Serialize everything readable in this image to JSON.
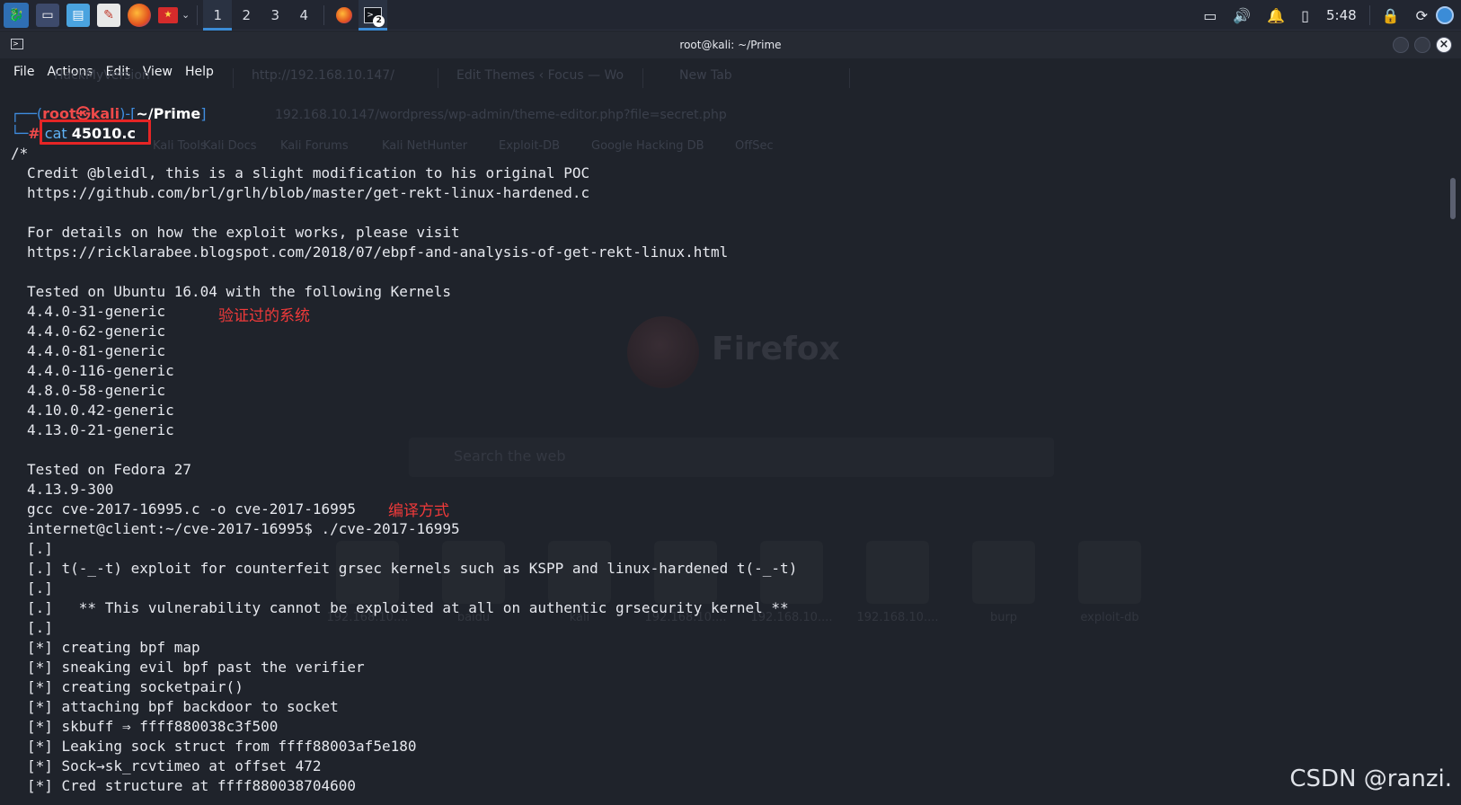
{
  "taskbar": {
    "workspaces": [
      "1",
      "2",
      "3",
      "4"
    ],
    "active_workspace": "1",
    "terminal_badge": "2",
    "clock": "5:48",
    "icons": [
      "kali-menu-icon",
      "terminal-icon",
      "file-manager-icon",
      "text-editor-icon",
      "firefox-icon",
      "flag-icon"
    ]
  },
  "window": {
    "title": "root@kali: ~/Prime"
  },
  "menu": [
    "File",
    "Actions",
    "Edit",
    "View",
    "Help"
  ],
  "ghost": {
    "tabs": [
      "HackMyVersion",
      "http://192.168.10.147/",
      "Edit Themes ‹ Focus — Wo",
      "New Tab"
    ],
    "url": "192.168.10.147/wordpress/wp-admin/theme-editor.php?file=secret.php",
    "bookmarks": [
      "Kali Linux",
      "Kali Tools",
      "Kali Docs",
      "Kali Forums",
      "Kali NetHunter",
      "Exploit-DB",
      "Google Hacking DB",
      "OffSec"
    ],
    "brand": "Firefox",
    "search_placeholder": "Search the web",
    "tiles": [
      "192.168.10....",
      "baidu",
      "kali",
      "192.168.10....",
      "192.168.10....",
      "192.168.10....",
      "burp",
      "exploit-db"
    ]
  },
  "prompt": {
    "user": "root",
    "at": "㉿",
    "host": "kali",
    "dir": "~/Prime",
    "command": "cat",
    "argument": "45010.c"
  },
  "output": [
    "/*",
    "Credit @bleidl, this is a slight modification to his original POC",
    "https://github.com/brl/grlh/blob/master/get-rekt-linux-hardened.c",
    "",
    "For details on how the exploit works, please visit",
    "https://ricklarabee.blogspot.com/2018/07/ebpf-and-analysis-of-get-rekt-linux.html",
    "",
    "Tested on Ubuntu 16.04 with the following Kernels",
    "4.4.0-31-generic",
    "4.4.0-62-generic",
    "4.4.0-81-generic",
    "4.4.0-116-generic",
    "4.8.0-58-generic",
    "4.10.0.42-generic",
    "4.13.0-21-generic",
    "",
    "Tested on Fedora 27",
    "4.13.9-300",
    "gcc cve-2017-16995.c -o cve-2017-16995",
    "internet@client:~/cve-2017-16995$ ./cve-2017-16995",
    "[.]",
    "[.] t(-_-t) exploit for counterfeit grsec kernels such as KSPP and linux-hardened t(-_-t)",
    "[.]",
    "[.]   ** This vulnerability cannot be exploited at all on authentic grsecurity kernel **",
    "[.]",
    "[*] creating bpf map",
    "[*] sneaking evil bpf past the verifier",
    "[*] creating socketpair()",
    "[*] attaching bpf backdoor to socket",
    "[*] skbuff ⇒ ffff880038c3f500",
    "[*] Leaking sock struct from ffff88003af5e180",
    "[*] Sock→sk_rcvtimeo at offset 472",
    "[*] Cred structure at ffff880038704600"
  ],
  "annotations": {
    "verified_systems": "验证过的系统",
    "compile_method": "编译方式"
  },
  "watermark": "CSDN @ranzi.",
  "colors": {
    "terminal_bg": "#1f232b",
    "prompt_blue": "#3f8de0",
    "prompt_red": "#f04a4a",
    "highlight_box": "#e52525",
    "accent": "#3b8cd7"
  }
}
